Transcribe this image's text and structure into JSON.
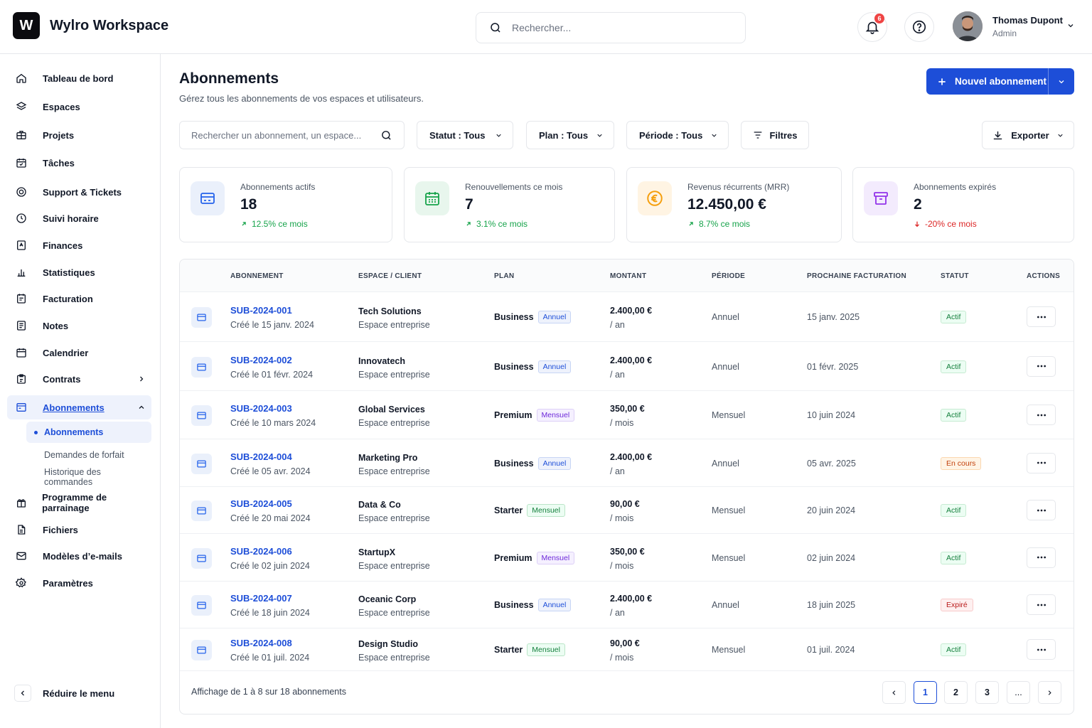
{
  "app": {
    "logo_letter": "W",
    "title": "Wylro Workspace"
  },
  "topbar": {
    "search_placeholder": "Rechercher...",
    "notifications_count": "6",
    "user_name": "Thomas Dupont",
    "user_role": "Admin"
  },
  "sidebar": {
    "items": [
      {
        "label": "Tableau de bord",
        "icon": "home-icon"
      },
      {
        "label": "Espaces",
        "icon": "layers-icon"
      },
      {
        "label": "Projets",
        "icon": "briefcase-icon"
      },
      {
        "label": "Tâches",
        "icon": "calendar-check-icon"
      },
      {
        "label": "Support & Tickets",
        "icon": "lifebuoy-icon"
      },
      {
        "label": "Suivi horaire",
        "icon": "clock-icon"
      },
      {
        "label": "Finances",
        "icon": "receipt-icon"
      },
      {
        "label": "Statistiques",
        "icon": "bar-chart-icon"
      },
      {
        "label": "Facturation",
        "icon": "invoice-icon"
      },
      {
        "label": "Notes",
        "icon": "note-icon"
      },
      {
        "label": "Calendrier",
        "icon": "calendar-icon"
      },
      {
        "label": "Contrats",
        "icon": "contract-icon"
      },
      {
        "label": "Abonnements",
        "icon": "subscription-icon"
      }
    ],
    "sub_items": [
      "Abonnements",
      "Demandes de forfait",
      "Historique des commandes"
    ],
    "items_after": [
      {
        "label": "Programme de parrainage",
        "icon": "gift-icon"
      },
      {
        "label": "Fichiers",
        "icon": "file-icon"
      },
      {
        "label": "Modèles d’e-mails",
        "icon": "mail-icon"
      },
      {
        "label": "Paramètres",
        "icon": "settings-icon"
      }
    ],
    "collapse_label": "Réduire le menu"
  },
  "header": {
    "title": "Abonnements",
    "subtitle": "Gérez tous les abonnements de vos espaces et utilisateurs.",
    "new_button": "Nouvel abonnement"
  },
  "filters": {
    "search_placeholder": "Rechercher un abonnement, un espace...",
    "status": "Statut : Tous",
    "plan": "Plan : Tous",
    "period": "Période : Tous",
    "filters_label": "Filtres",
    "export_label": "Exporter"
  },
  "stats": [
    {
      "label": "Abonnements actifs",
      "value": "18",
      "change": "12.5% ce mois",
      "trend": "up",
      "color": "#2563eb",
      "bg": "#eaf0fb"
    },
    {
      "label": "Renouvellements ce mois",
      "value": "7",
      "change": "3.1% ce mois",
      "trend": "up",
      "color": "#16a34a",
      "bg": "#e8f6ed"
    },
    {
      "label": "Revenus récurrents (MRR)",
      "value": "12.450,00 €",
      "change": "8.7% ce mois",
      "trend": "up",
      "color": "#f59e0b",
      "bg": "#fff4e3"
    },
    {
      "label": "Abonnements expirés",
      "value": "2",
      "change": "-20% ce mois",
      "trend": "down",
      "color": "#9333ea",
      "bg": "#f3ebfd"
    }
  ],
  "table": {
    "headers": [
      "ABONNEMENT",
      "ESPACE / CLIENT",
      "PLAN",
      "MONTANT",
      "PÉRIODE",
      "PROCHAINE FACTURATION",
      "STATUT",
      "ACTIONS"
    ],
    "rows": [
      {
        "id": "SUB-2024-001",
        "created": "Créé le 15 janv. 2024",
        "client": "Tech Solutions",
        "client_type": "Espace entreprise",
        "plan": "Business",
        "plan_badge": "Annuel",
        "amount": "2.400,00 €",
        "amount_unit": "/ an",
        "period": "Annuel",
        "next": "15 janv. 2025",
        "status": "Actif",
        "status_key": "actif"
      },
      {
        "id": "SUB-2024-002",
        "created": "Créé le 01 févr. 2024",
        "client": "Innovatech",
        "client_type": "Espace entreprise",
        "plan": "Business",
        "plan_badge": "Annuel",
        "amount": "2.400,00 €",
        "amount_unit": "/ an",
        "period": "Annuel",
        "next": "01 févr. 2025",
        "status": "Actif",
        "status_key": "actif"
      },
      {
        "id": "SUB-2024-003",
        "created": "Créé le 10 mars 2024",
        "client": "Global Services",
        "client_type": "Espace entreprise",
        "plan": "Premium",
        "plan_badge": "Mensuel",
        "amount": "350,00 €",
        "amount_unit": "/ mois",
        "period": "Mensuel",
        "next": "10 juin 2024",
        "status": "Actif",
        "status_key": "actif"
      },
      {
        "id": "SUB-2024-004",
        "created": "Créé le 05 avr. 2024",
        "client": "Marketing Pro",
        "client_type": "Espace entreprise",
        "plan": "Business",
        "plan_badge": "Annuel",
        "amount": "2.400,00 €",
        "amount_unit": "/ an",
        "period": "Annuel",
        "next": "05 avr. 2025",
        "status": "En cours",
        "status_key": "encours"
      },
      {
        "id": "SUB-2024-005",
        "created": "Créé le 20 mai 2024",
        "client": "Data & Co",
        "client_type": "Espace entreprise",
        "plan": "Starter",
        "plan_badge": "Mensuel",
        "amount": "90,00 €",
        "amount_unit": "/ mois",
        "period": "Mensuel",
        "next": "20 juin 2024",
        "status": "Actif",
        "status_key": "actif"
      },
      {
        "id": "SUB-2024-006",
        "created": "Créé le 02 juin 2024",
        "client": "StartupX",
        "client_type": "Espace entreprise",
        "plan": "Premium",
        "plan_badge": "Mensuel",
        "amount": "350,00 €",
        "amount_unit": "/ mois",
        "period": "Mensuel",
        "next": "02 juin 2024",
        "status": "Actif",
        "status_key": "actif"
      },
      {
        "id": "SUB-2024-007",
        "created": "Créé le 18 juin 2024",
        "client": "Oceanic Corp",
        "client_type": "Espace entreprise",
        "plan": "Business",
        "plan_badge": "Annuel",
        "amount": "2.400,00 €",
        "amount_unit": "/ an",
        "period": "Annuel",
        "next": "18 juin 2025",
        "status": "Expiré",
        "status_key": "expire"
      },
      {
        "id": "SUB-2024-008",
        "created": "Créé le 01 juil. 2024",
        "client": "Design Studio",
        "client_type": "Espace entreprise",
        "plan": "Starter",
        "plan_badge": "Mensuel",
        "amount": "90,00 €",
        "amount_unit": "/ mois",
        "period": "Mensuel",
        "next": "01 juil. 2024",
        "status": "Actif",
        "status_key": "actif"
      }
    ]
  },
  "pagination": {
    "summary": "Affichage de 1 à 8 sur 18 abonnements",
    "pages": [
      "1",
      "2",
      "3",
      "..."
    ],
    "current": "1"
  }
}
